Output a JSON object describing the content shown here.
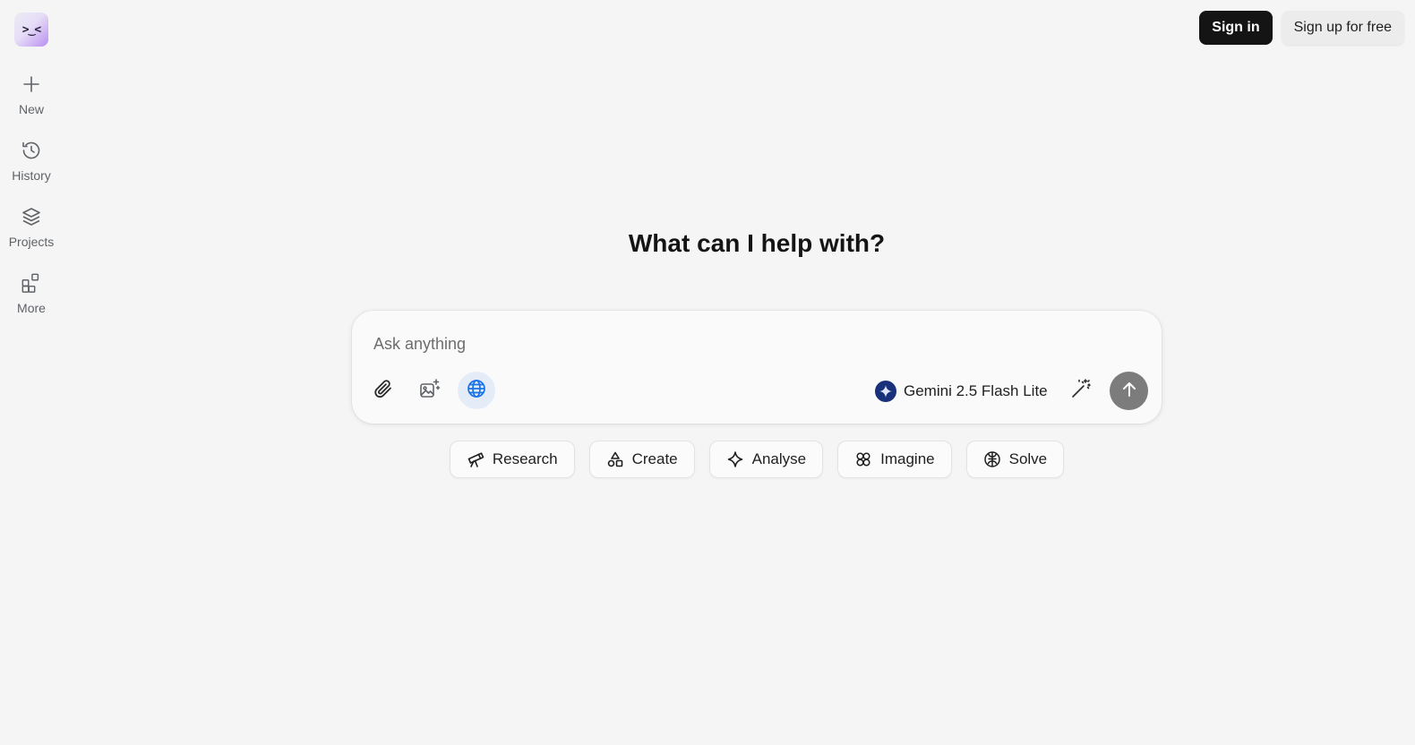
{
  "sidebar": {
    "logo_text": ">‿<",
    "items": [
      {
        "label": "New",
        "icon": "plus-icon"
      },
      {
        "label": "History",
        "icon": "history-icon"
      },
      {
        "label": "Projects",
        "icon": "layers-icon"
      },
      {
        "label": "More",
        "icon": "apps-icon"
      }
    ]
  },
  "auth": {
    "signin_label": "Sign in",
    "signup_label": "Sign up for free"
  },
  "main": {
    "headline": "What can I help with?",
    "composer": {
      "placeholder": "Ask anything",
      "value": "",
      "model_name": "Gemini 2.5 Flash Lite"
    },
    "chips": [
      {
        "label": "Research",
        "icon": "telescope-icon"
      },
      {
        "label": "Create",
        "icon": "shapes-icon"
      },
      {
        "label": "Analyse",
        "icon": "sparkle-icon"
      },
      {
        "label": "Imagine",
        "icon": "imagine-icon"
      },
      {
        "label": "Solve",
        "icon": "brain-icon"
      }
    ]
  },
  "colors": {
    "background": "#f5f5f5",
    "signin_bg": "#141414",
    "web_search_active_bg": "#e4edf7",
    "web_icon": "#1a73e8",
    "model_badge": "#18317a",
    "send_bg": "#7c7c7c"
  }
}
